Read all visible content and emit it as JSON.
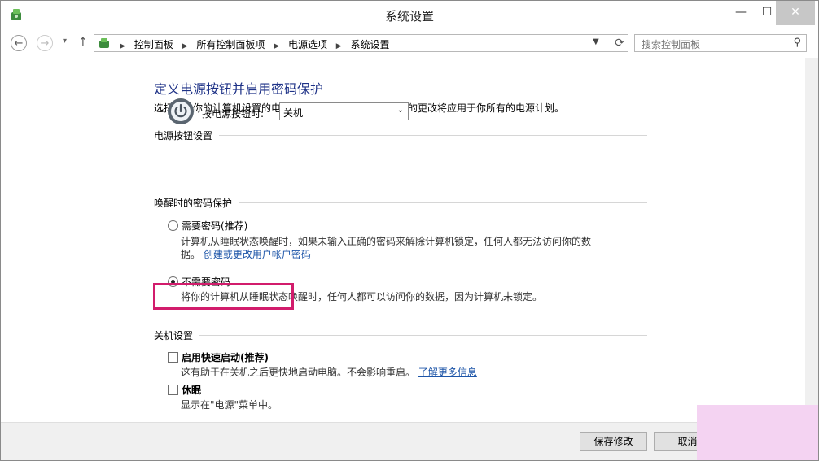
{
  "window": {
    "title": "系统设置",
    "minimize": "—",
    "maximize": "☐",
    "close": "✕"
  },
  "nav": {
    "back": "←",
    "forward": "→",
    "recent": "▾",
    "up": "↑",
    "breadcrumbs": [
      "控制面板",
      "所有控制面板项",
      "电源选项",
      "系统设置"
    ],
    "search_placeholder": "搜索控制面板"
  },
  "page": {
    "heading": "定义电源按钮并启用密码保护",
    "description": "选择要为你的计算机设置的电源设置。在此页上对设置所做的更改将应用于你所有的电源计划。"
  },
  "power_buttons": {
    "section_label": "电源按钮设置",
    "power_button_label": "按电源按钮时:",
    "power_button_value": "关机"
  },
  "wake_password": {
    "section_label": "唤醒时的密码保护",
    "options": [
      {
        "title": "需要密码(推荐)",
        "desc": "计算机从睡眠状态唤醒时，如果未输入正确的密码来解除计算机锁定，任何人都无法访问你的数",
        "desc2": "据。",
        "link": "创建或更改用户帐户密码",
        "selected": false
      },
      {
        "title": "不需要密码",
        "desc": "将你的计算机从睡眠状态唤醒时，任何人都可以访问你的数据，因为计算机未锁定。",
        "selected": true
      }
    ]
  },
  "shutdown": {
    "section_label": "关机设置",
    "fast_startup": {
      "label": "启用快速启动(推荐)",
      "desc": "这有助于在关机之后更快地启动电脑。不会影响重启。",
      "link": "了解更多信息",
      "checked": false
    },
    "hibernate": {
      "label": "休眠",
      "desc": "显示在\"电源\"菜单中。",
      "checked": false
    }
  },
  "footer": {
    "save_label": "保存修改",
    "cancel_label": "取消"
  },
  "colors": {
    "heading": "#1e3287",
    "link": "#1d55a8",
    "highlight": "#d21c6c",
    "pink_overlay": "#f4d3f2"
  }
}
